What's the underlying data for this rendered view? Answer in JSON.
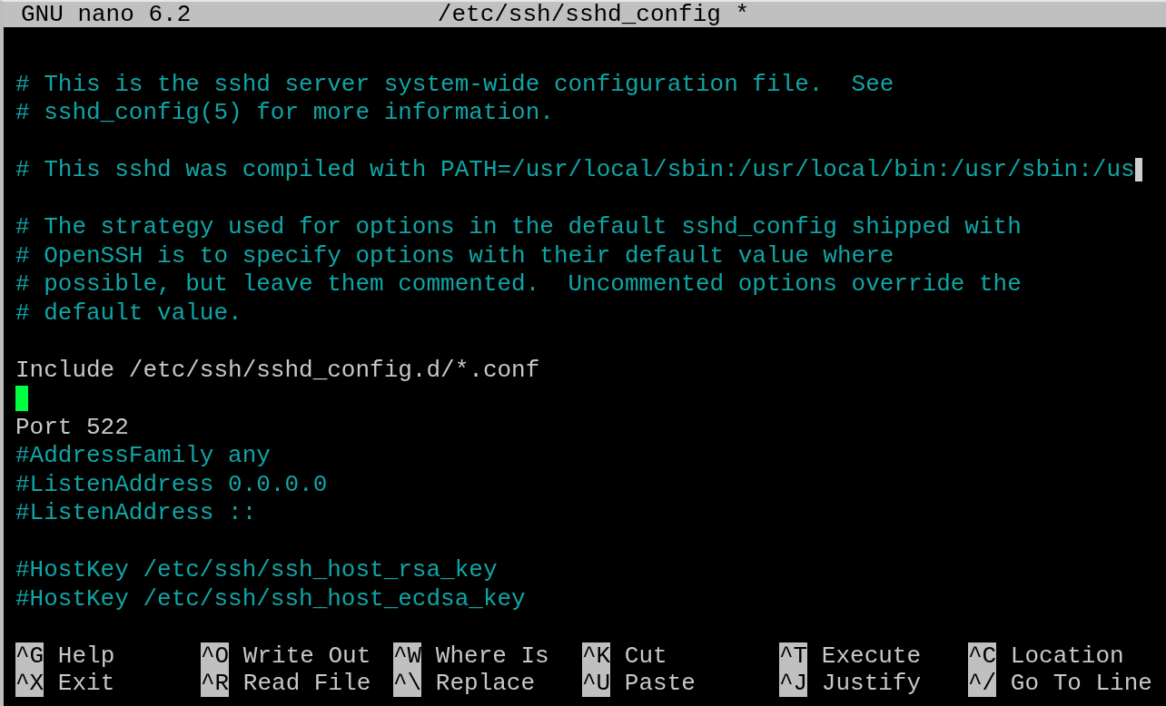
{
  "title_bar": {
    "app": "GNU nano 6.2",
    "filename": "/etc/ssh/sshd_config *"
  },
  "lines": [
    {
      "kind": "blank"
    },
    {
      "kind": "comment",
      "text": "# This is the sshd server system-wide configuration file.  See"
    },
    {
      "kind": "comment",
      "text": "# sshd_config(5) for more information."
    },
    {
      "kind": "blank"
    },
    {
      "kind": "comment",
      "text": "# This sshd was compiled with PATH=/usr/local/sbin:/usr/local/bin:/usr/sbin:/us",
      "truncated": true
    },
    {
      "kind": "blank"
    },
    {
      "kind": "comment",
      "text": "# The strategy used for options in the default sshd_config shipped with"
    },
    {
      "kind": "comment",
      "text": "# OpenSSH is to specify options with their default value where"
    },
    {
      "kind": "comment",
      "text": "# possible, but leave them commented.  Uncommented options override the"
    },
    {
      "kind": "comment",
      "text": "# default value."
    },
    {
      "kind": "blank"
    },
    {
      "kind": "directive",
      "text": "Include /etc/ssh/sshd_config.d/*.conf"
    },
    {
      "kind": "blank",
      "cursor": true
    },
    {
      "kind": "directive",
      "text": "Port 522"
    },
    {
      "kind": "comment",
      "text": "#AddressFamily any"
    },
    {
      "kind": "comment",
      "text": "#ListenAddress 0.0.0.0"
    },
    {
      "kind": "comment",
      "text": "#ListenAddress ::"
    },
    {
      "kind": "blank"
    },
    {
      "kind": "comment",
      "text": "#HostKey /etc/ssh/ssh_host_rsa_key"
    },
    {
      "kind": "comment",
      "text": "#HostKey /etc/ssh/ssh_host_ecdsa_key"
    },
    {
      "kind": "blank"
    }
  ],
  "shortcuts": [
    [
      {
        "key": "^G",
        "label": "Help"
      },
      {
        "key": "^O",
        "label": "Write Out"
      },
      {
        "key": "^W",
        "label": "Where Is"
      },
      {
        "key": "^K",
        "label": "Cut"
      },
      {
        "key": "^T",
        "label": "Execute"
      },
      {
        "key": "^C",
        "label": "Location"
      }
    ],
    [
      {
        "key": "^X",
        "label": "Exit"
      },
      {
        "key": "^R",
        "label": "Read File"
      },
      {
        "key": "^\\",
        "label": "Replace"
      },
      {
        "key": "^U",
        "label": "Paste"
      },
      {
        "key": "^J",
        "label": "Justify"
      },
      {
        "key": "^/",
        "label": "Go To Line"
      }
    ]
  ]
}
